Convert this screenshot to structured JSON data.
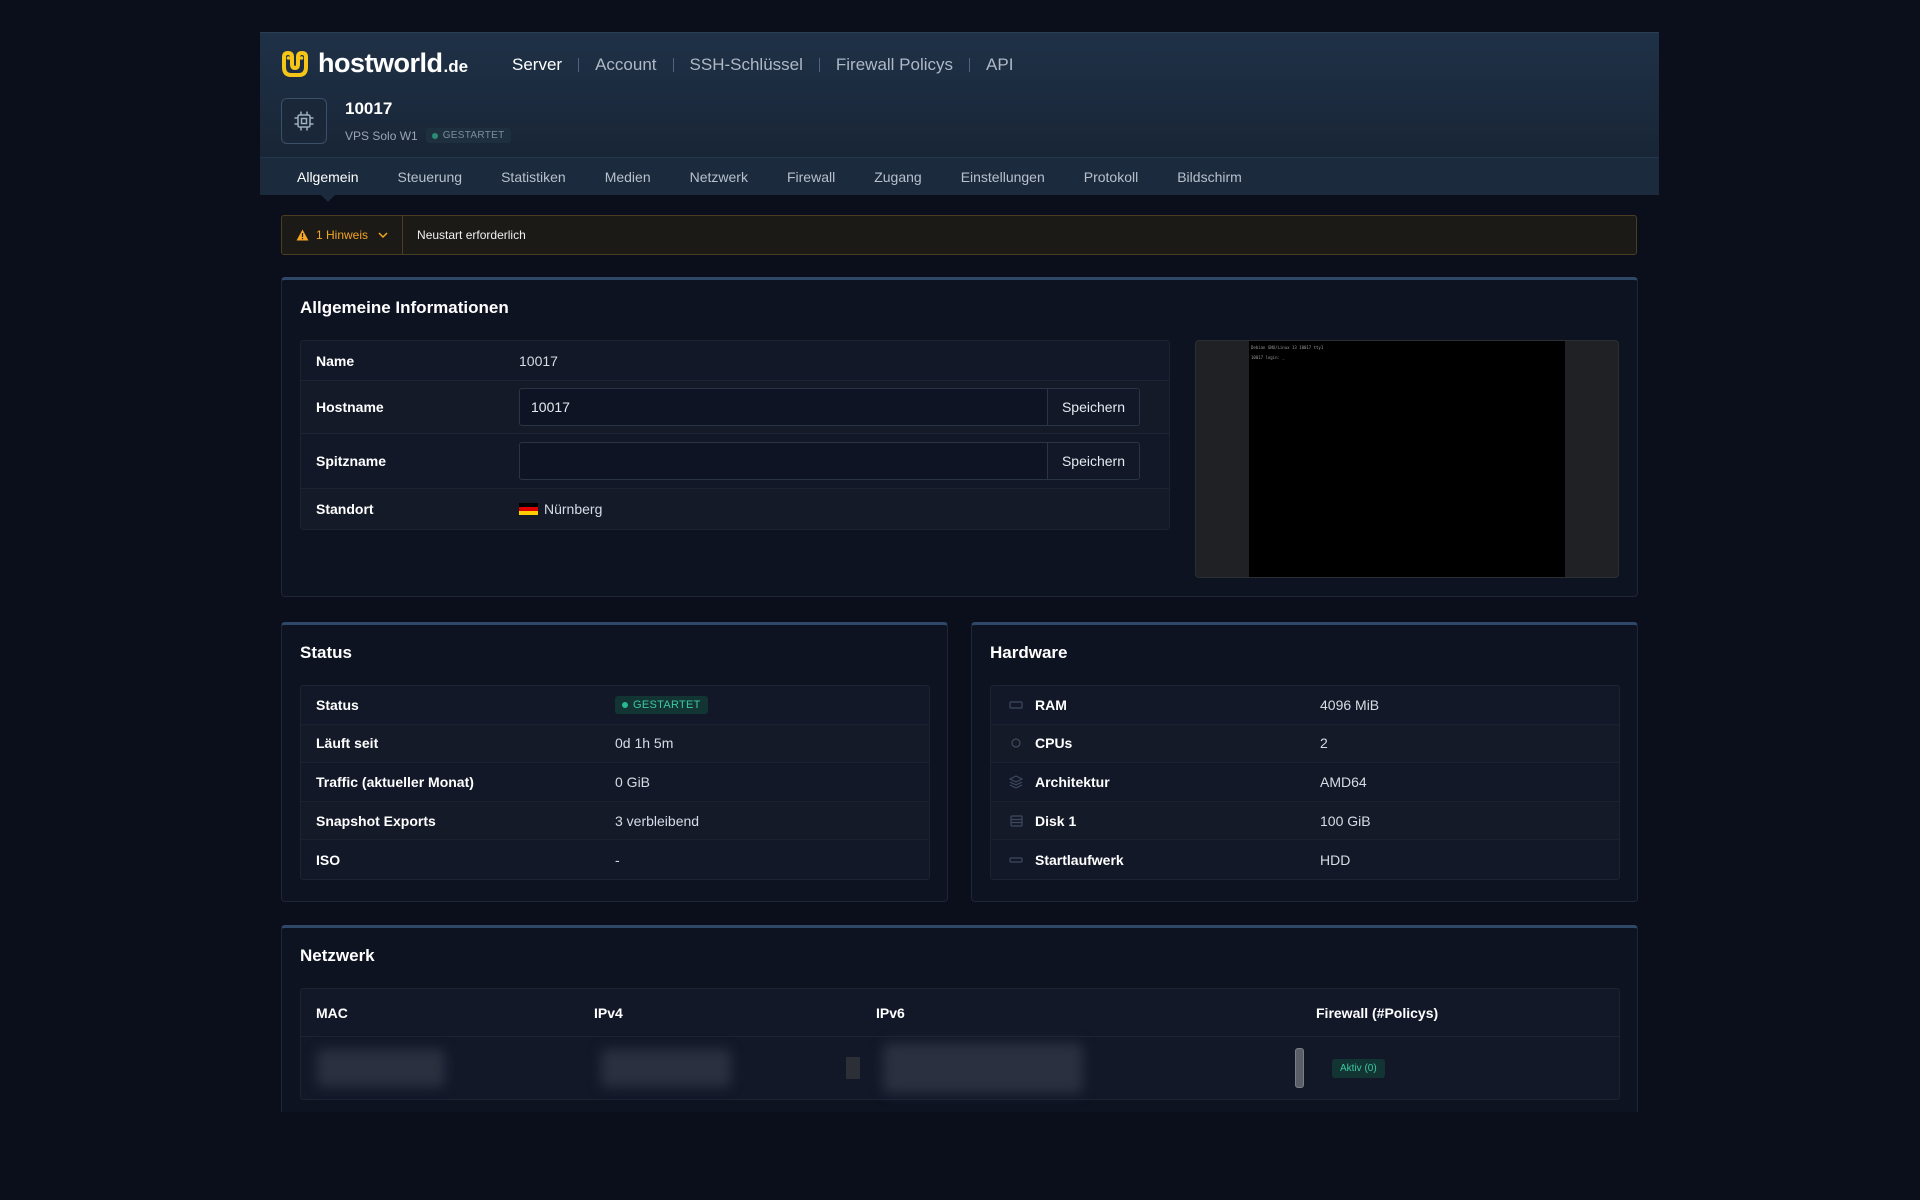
{
  "brand": {
    "name": "hostworld",
    "tld": ".de",
    "accent": "#f5c518"
  },
  "top_nav": [
    "Server",
    "Account",
    "SSH-Schlüssel",
    "Firewall Policys",
    "API"
  ],
  "server": {
    "id": "10017",
    "plan": "VPS Solo W1",
    "state": "GESTARTET",
    "icon": "cpu-chip-icon"
  },
  "tabs": [
    "Allgemein",
    "Steuerung",
    "Statistiken",
    "Medien",
    "Netzwerk",
    "Firewall",
    "Zugang",
    "Einstellungen",
    "Protokoll",
    "Bildschirm"
  ],
  "notice": {
    "count_label": "1 Hinweis",
    "message": "Neustart erforderlich",
    "color": "#f5a623"
  },
  "general": {
    "title": "Allgemeine Informationen",
    "name_label": "Name",
    "name_value": "10017",
    "hostname_label": "Hostname",
    "hostname_value": "10017",
    "save_label": "Speichern",
    "nickname_label": "Spitzname",
    "nickname_value": "",
    "location_label": "Standort",
    "location_value": "Nürnberg",
    "console_lines": [
      "Debian GNU/Linux 13 10017 tty1",
      "10017 login: _"
    ]
  },
  "status": {
    "title": "Status",
    "rows": [
      {
        "label": "Status",
        "value": "GESTARTET"
      },
      {
        "label": "Läuft seit",
        "value": "0d 1h 5m"
      },
      {
        "label": "Traffic (aktueller Monat)",
        "value": "0 GiB"
      },
      {
        "label": "Snapshot Exports",
        "value": "3 verbleibend"
      },
      {
        "label": "ISO",
        "value": "-"
      }
    ]
  },
  "hardware": {
    "title": "Hardware",
    "rows": [
      {
        "label": "RAM",
        "value": "4096 MiB",
        "icon": "memory-icon"
      },
      {
        "label": "CPUs",
        "value": "2",
        "icon": "cpu-icon"
      },
      {
        "label": "Architektur",
        "value": "AMD64",
        "icon": "layers-icon"
      },
      {
        "label": "Disk 1",
        "value": "100 GiB",
        "icon": "disk-icon"
      },
      {
        "label": "Startlaufwerk",
        "value": "HDD",
        "icon": "drive-icon"
      }
    ]
  },
  "network": {
    "title": "Netzwerk",
    "columns": [
      "MAC",
      "IPv4",
      "IPv6",
      "Firewall (#Policys)"
    ],
    "firewall_value": "Aktiv (0)"
  }
}
